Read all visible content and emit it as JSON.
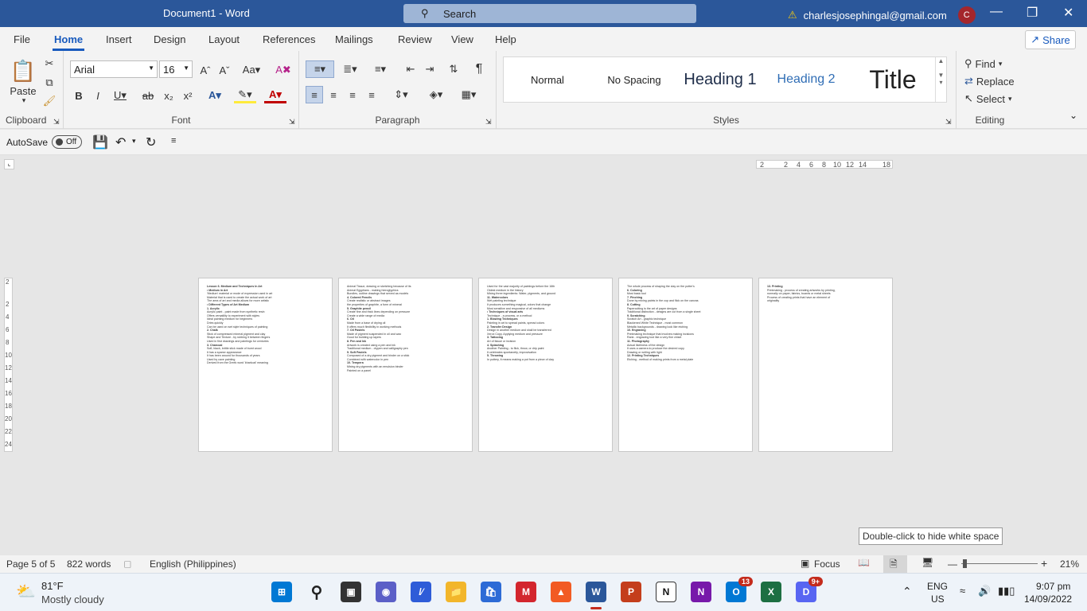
{
  "window": {
    "title": "Document1 - Word",
    "search_placeholder": "Search",
    "account_email": "charlesjosephingal@gmail.com",
    "avatar_initial": "C"
  },
  "menu": {
    "tabs": [
      "File",
      "Home",
      "Insert",
      "Design",
      "Layout",
      "References",
      "Mailings",
      "Review",
      "View",
      "Help"
    ],
    "active": "Home",
    "share_label": "Share"
  },
  "ribbon": {
    "clipboard": {
      "paste_label": "Paste",
      "group_label": "Clipboard"
    },
    "font": {
      "family": "Arial",
      "size": "16",
      "group_label": "Font"
    },
    "paragraph": {
      "group_label": "Paragraph"
    },
    "styles": {
      "items": [
        "Normal",
        "No Spacing",
        "Heading 1",
        "Heading 2",
        "Title"
      ],
      "group_label": "Styles"
    },
    "editing": {
      "find": "Find",
      "replace": "Replace",
      "select": "Select",
      "group_label": "Editing"
    }
  },
  "qat": {
    "autosave_label": "AutoSave",
    "autosave_state": "Off"
  },
  "ruler": {
    "ticks": [
      "2",
      "2",
      "4",
      "6",
      "8",
      "10",
      "12",
      "14",
      "18"
    ]
  },
  "vruler": {
    "ticks": [
      "2",
      "2",
      "4",
      "6",
      "8",
      "10",
      "12",
      "14",
      "16",
      "18",
      "20",
      "22",
      "24"
    ]
  },
  "pages": [
    {
      "lines": [
        "Lesson 6. Medium and Techniques In Art",
        "• Medium in Art",
        "'Medium' material or mode of expression used in art",
        "Material that is used to create the actual work of art",
        "The area of art and media allows for more artistic",
        "• Different Types of Art Medium",
        "1. Acrylic",
        "Acrylic paint - paint made from synthetic resin",
        "Offers versatility to experiment with styles",
        "Ideal painting medium for beginners",
        "Dries quickly",
        "Can be used on wet style techniques of painting",
        "2. Chalk",
        "Stick of compressed mineral pigment and clay",
        "Shape and Texture - by rubbing it between fingers",
        "Used in first drawings and paintings for centuries",
        "3. Charcoal",
        "Soft, black, brittle stick made of burnt wood",
        "It has a sparse appearance",
        "It has been around for thousands of years",
        "Used by cave painting",
        "Derived from the Greek word 'kharkoal' meaning"
      ]
    },
    {
      "lines": [
        "Animal Tissue, drawing or sketching because of its",
        "Animal Egyptians - making hieroglyphics",
        "Bundles, outline drawings that served as models",
        "4. Colored Pencils",
        "Create realistic or abstract images",
        "the properties of graphite, a form of mineral",
        "5. Graphite pencil",
        "Create fine and thick lines depending on pressure",
        "Create a wide range of media",
        "6. Oil",
        "Made from a base of drying oil",
        "It offers much flexibility in working methods",
        "7. Oil Pastels",
        "Made of pigment suspended in oil and wax",
        "Good for building up layers",
        "8. Pen and Ink",
        "Artwork is created using a pen and ink",
        "Traditional medium - drypen and calligraphy pen",
        "9. Soft Pastels",
        "Composed of a dry pigment and binder on a stick",
        "Combined with watercolor in pen",
        "10. Tempera",
        "Mixing dry pigments with an emulsion binder",
        "Painted on a panel"
      ]
    },
    {
      "lines": [
        "Used for the vast majority of paintings before the 16th",
        "Oldest medium in the history",
        "Mixing three ingredients: Water, pigments, and ground",
        "11. Watercolors",
        "Wet painting technique",
        "It produces something magical, colors that change",
        "Most sensitive and responsive of all mediums",
        "• Techniques of visual arts",
        "Technique - a process, or a method",
        "1. Blowing Techniques",
        "Painting in art to spread paints, spread colors",
        "2. Transfer Design",
        "Design in another medium and shall be transferred",
        "Xerox Copy, Applying medium and pressure",
        "3. Tattooing",
        "Art of tissue or incision",
        "4. Splashing",
        "Another Painting - to flick, throw, or drip paint",
        "It celebrates spontaneity, improvisation",
        "5. Throwing",
        "In pottery, it means making a pot from a piece of clay"
      ]
    },
    {
      "lines": [
        "The whole process of shaping the clay on the potter's",
        "6. Coloring",
        "Most basic tool",
        "7. Pinching",
        "Done by mixing paints in the cup and flick on the canvas",
        "8. Cutting",
        "Papercutting is the art of paper designs",
        "Traditional distinction - designs are cut from a single sheet",
        "9. Scratching",
        "Scratch Art - graphic technique",
        "Blackened White Technique - most common",
        "Metallic backgrounds - drawing look like etching",
        "10. Engraving",
        "Printmaking technique that involves making incisions",
        "Rank - engraving tool like a very fine chisel",
        "11. Photography",
        "Actual likeliness of the design",
        "It uses a camera to produce the desired copy",
        "Drawing or writing with light",
        "12. Printing Techniques",
        "Etching - method of making prints from a metal plate"
      ]
    },
    {
      "lines": [
        "13. Printing",
        "Printmaking - process of creating artworks by printing,",
        "normally on paper, fabrics, boards or metal sheets",
        "Process of creating prints that have an element of",
        "originality"
      ]
    }
  ],
  "tooltip": "Double-click to hide white space",
  "status": {
    "page": "Page 5 of 5",
    "words": "822 words",
    "language": "English (Philippines)",
    "focus": "Focus",
    "zoom": "21%"
  },
  "taskbar": {
    "temp": "81°F",
    "weather": "Mostly cloudy",
    "lang": "ENG",
    "region": "US",
    "time": "9:07 pm",
    "date": "14/09/2022",
    "badge_outlook": "13",
    "badge_discord": "9+"
  }
}
